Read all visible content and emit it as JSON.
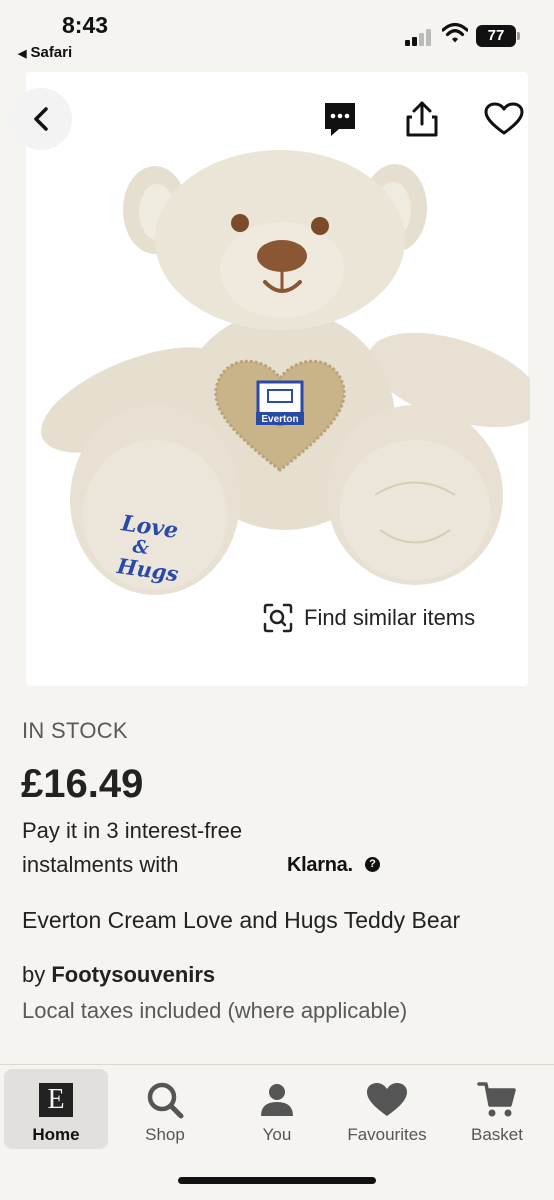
{
  "status_bar": {
    "time": "8:43",
    "back_app": "Safari",
    "battery": "77"
  },
  "toolbar": {
    "back_icon": "chevron-left-icon",
    "chat_icon": "chat-bubble-icon",
    "share_icon": "share-icon",
    "favourite_icon": "heart-outline-icon"
  },
  "image": {
    "find_similar_label": "Find similar items",
    "foot_text_lines": [
      "Love",
      "&",
      "Hugs"
    ],
    "badge_text": "Everton"
  },
  "product": {
    "stock_status": "IN STOCK",
    "price": "£16.49",
    "klarna_line1": "Pay it in 3 interest-free",
    "klarna_line2": "instalments with",
    "klarna_brand": "Klarna.",
    "klarna_info": "?",
    "title": "Everton Cream Love and Hugs Teddy Bear",
    "seller_prefix": "by ",
    "seller_name": "Footysouvenirs",
    "taxes_note": "Local taxes included (where applicable)"
  },
  "bottom_nav": {
    "items": [
      {
        "label": "Home",
        "icon": "etsy-logo-icon",
        "active": true
      },
      {
        "label": "Shop",
        "icon": "search-icon"
      },
      {
        "label": "You",
        "icon": "user-icon"
      },
      {
        "label": "Favourites",
        "icon": "heart-icon"
      },
      {
        "label": "Basket",
        "icon": "cart-icon"
      }
    ]
  },
  "colors": {
    "background": "#f5f4f0",
    "text": "#222222",
    "muted": "#595959",
    "bear_fur": "#e8e1d3",
    "badge_blue": "#2a4aa8"
  }
}
